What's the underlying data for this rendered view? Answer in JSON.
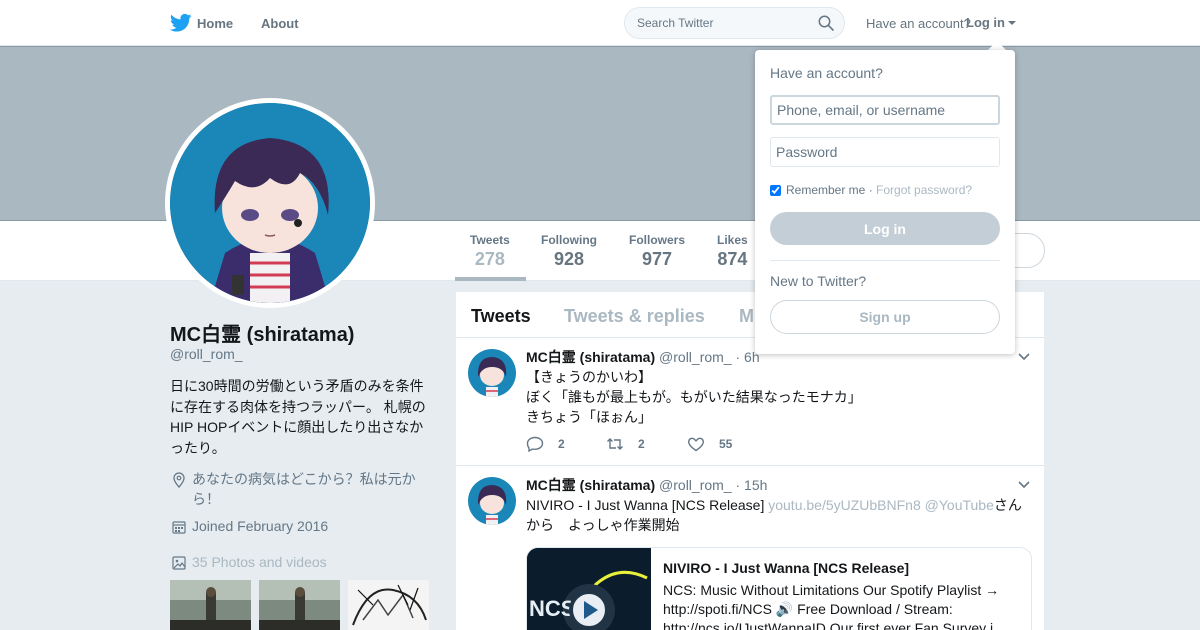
{
  "colors": {
    "brand": "#1da1f2",
    "banner": "#aab8c2",
    "muted": "#657786"
  },
  "nav": {
    "home": "Home",
    "about": "About",
    "search_placeholder": "Search Twitter",
    "have_account": "Have an account?",
    "login": "Log in"
  },
  "stats": [
    {
      "label": "Tweets",
      "value": "278"
    },
    {
      "label": "Following",
      "value": "928"
    },
    {
      "label": "Followers",
      "value": "977"
    },
    {
      "label": "Likes",
      "value": "874"
    }
  ],
  "profile": {
    "name": "MC白霊 (shiratama)",
    "handle": "@roll_rom_",
    "bio": "日に30時間の労働という矛盾のみを条件に存在する肉体を持つラッパー。 札幌のHIP HOPイベントに顔出したり出さなかったり。",
    "location": "あなたの病気はどこから？私は元から！",
    "joined": "Joined February 2016",
    "photos": "35 Photos and videos"
  },
  "tabs": [
    "Tweets",
    "Tweets & replies",
    "M"
  ],
  "tweets": [
    {
      "name": "MC白霊 (shiratama)",
      "handle": "@roll_rom_",
      "time": "· 6h",
      "lines": [
        "【きょうのかいわ】",
        "ぼく「誰もが最上もが。もがいた結果なったモナカ」",
        "きちょう「ほぉん」"
      ],
      "replies": "2",
      "retweets": "2",
      "likes": "55"
    },
    {
      "name": "MC白霊 (shiratama)",
      "handle": "@roll_rom_",
      "time": "· 15h",
      "text_before": "NIVIRO - I Just Wanna [NCS Release] ",
      "link1": "youtu.be/5yUZUbBNFn8",
      "link2": " @YouTube",
      "text_after": "さんから　よっしゃ作業開始",
      "card_title": "NIVIRO - I Just Wanna [NCS Release]",
      "card_desc": "NCS: Music Without Limitations Our Spotify Playlist → http://spoti.fi/NCS 🔊 Free Download / Stream: http://ncs.io/IJustWannaID Our first ever Fan Survey i..."
    }
  ],
  "login_box": {
    "title": "Have an account?",
    "user_placeholder": "Phone, email, or username",
    "password_placeholder": "Password",
    "remember": "Remember me",
    "separator": " · ",
    "forgot": "Forgot password?",
    "login_button": "Log in",
    "new_text": "New to Twitter?",
    "signup_button": "Sign up"
  }
}
